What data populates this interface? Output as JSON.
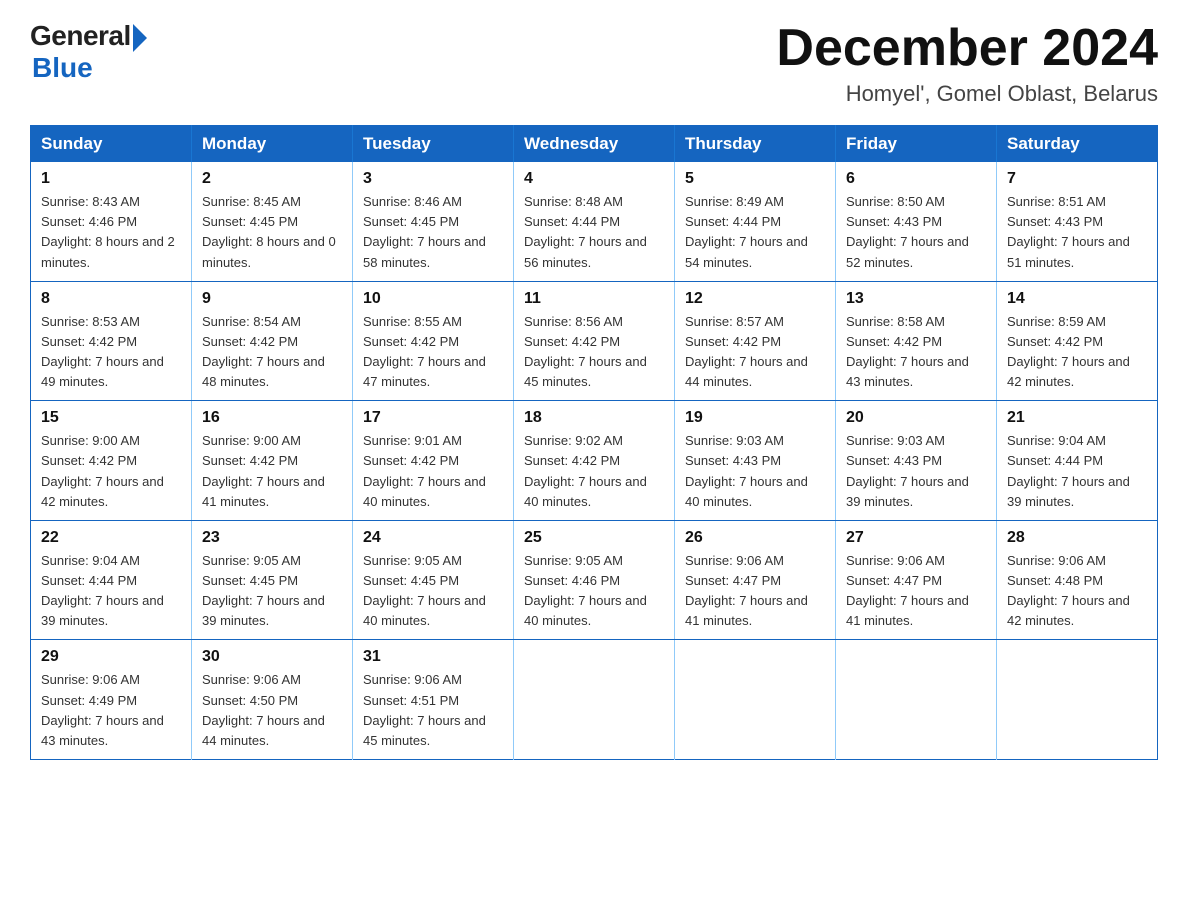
{
  "logo": {
    "general": "General",
    "blue": "Blue"
  },
  "title": {
    "month_year": "December 2024",
    "location": "Homyel', Gomel Oblast, Belarus"
  },
  "header_row": [
    "Sunday",
    "Monday",
    "Tuesday",
    "Wednesday",
    "Thursday",
    "Friday",
    "Saturday"
  ],
  "weeks": [
    [
      {
        "day": "1",
        "sunrise": "8:43 AM",
        "sunset": "4:46 PM",
        "daylight": "8 hours and 2 minutes."
      },
      {
        "day": "2",
        "sunrise": "8:45 AM",
        "sunset": "4:45 PM",
        "daylight": "8 hours and 0 minutes."
      },
      {
        "day": "3",
        "sunrise": "8:46 AM",
        "sunset": "4:45 PM",
        "daylight": "7 hours and 58 minutes."
      },
      {
        "day": "4",
        "sunrise": "8:48 AM",
        "sunset": "4:44 PM",
        "daylight": "7 hours and 56 minutes."
      },
      {
        "day": "5",
        "sunrise": "8:49 AM",
        "sunset": "4:44 PM",
        "daylight": "7 hours and 54 minutes."
      },
      {
        "day": "6",
        "sunrise": "8:50 AM",
        "sunset": "4:43 PM",
        "daylight": "7 hours and 52 minutes."
      },
      {
        "day": "7",
        "sunrise": "8:51 AM",
        "sunset": "4:43 PM",
        "daylight": "7 hours and 51 minutes."
      }
    ],
    [
      {
        "day": "8",
        "sunrise": "8:53 AM",
        "sunset": "4:42 PM",
        "daylight": "7 hours and 49 minutes."
      },
      {
        "day": "9",
        "sunrise": "8:54 AM",
        "sunset": "4:42 PM",
        "daylight": "7 hours and 48 minutes."
      },
      {
        "day": "10",
        "sunrise": "8:55 AM",
        "sunset": "4:42 PM",
        "daylight": "7 hours and 47 minutes."
      },
      {
        "day": "11",
        "sunrise": "8:56 AM",
        "sunset": "4:42 PM",
        "daylight": "7 hours and 45 minutes."
      },
      {
        "day": "12",
        "sunrise": "8:57 AM",
        "sunset": "4:42 PM",
        "daylight": "7 hours and 44 minutes."
      },
      {
        "day": "13",
        "sunrise": "8:58 AM",
        "sunset": "4:42 PM",
        "daylight": "7 hours and 43 minutes."
      },
      {
        "day": "14",
        "sunrise": "8:59 AM",
        "sunset": "4:42 PM",
        "daylight": "7 hours and 42 minutes."
      }
    ],
    [
      {
        "day": "15",
        "sunrise": "9:00 AM",
        "sunset": "4:42 PM",
        "daylight": "7 hours and 42 minutes."
      },
      {
        "day": "16",
        "sunrise": "9:00 AM",
        "sunset": "4:42 PM",
        "daylight": "7 hours and 41 minutes."
      },
      {
        "day": "17",
        "sunrise": "9:01 AM",
        "sunset": "4:42 PM",
        "daylight": "7 hours and 40 minutes."
      },
      {
        "day": "18",
        "sunrise": "9:02 AM",
        "sunset": "4:42 PM",
        "daylight": "7 hours and 40 minutes."
      },
      {
        "day": "19",
        "sunrise": "9:03 AM",
        "sunset": "4:43 PM",
        "daylight": "7 hours and 40 minutes."
      },
      {
        "day": "20",
        "sunrise": "9:03 AM",
        "sunset": "4:43 PM",
        "daylight": "7 hours and 39 minutes."
      },
      {
        "day": "21",
        "sunrise": "9:04 AM",
        "sunset": "4:44 PM",
        "daylight": "7 hours and 39 minutes."
      }
    ],
    [
      {
        "day": "22",
        "sunrise": "9:04 AM",
        "sunset": "4:44 PM",
        "daylight": "7 hours and 39 minutes."
      },
      {
        "day": "23",
        "sunrise": "9:05 AM",
        "sunset": "4:45 PM",
        "daylight": "7 hours and 39 minutes."
      },
      {
        "day": "24",
        "sunrise": "9:05 AM",
        "sunset": "4:45 PM",
        "daylight": "7 hours and 40 minutes."
      },
      {
        "day": "25",
        "sunrise": "9:05 AM",
        "sunset": "4:46 PM",
        "daylight": "7 hours and 40 minutes."
      },
      {
        "day": "26",
        "sunrise": "9:06 AM",
        "sunset": "4:47 PM",
        "daylight": "7 hours and 41 minutes."
      },
      {
        "day": "27",
        "sunrise": "9:06 AM",
        "sunset": "4:47 PM",
        "daylight": "7 hours and 41 minutes."
      },
      {
        "day": "28",
        "sunrise": "9:06 AM",
        "sunset": "4:48 PM",
        "daylight": "7 hours and 42 minutes."
      }
    ],
    [
      {
        "day": "29",
        "sunrise": "9:06 AM",
        "sunset": "4:49 PM",
        "daylight": "7 hours and 43 minutes."
      },
      {
        "day": "30",
        "sunrise": "9:06 AM",
        "sunset": "4:50 PM",
        "daylight": "7 hours and 44 minutes."
      },
      {
        "day": "31",
        "sunrise": "9:06 AM",
        "sunset": "4:51 PM",
        "daylight": "7 hours and 45 minutes."
      },
      null,
      null,
      null,
      null
    ]
  ]
}
